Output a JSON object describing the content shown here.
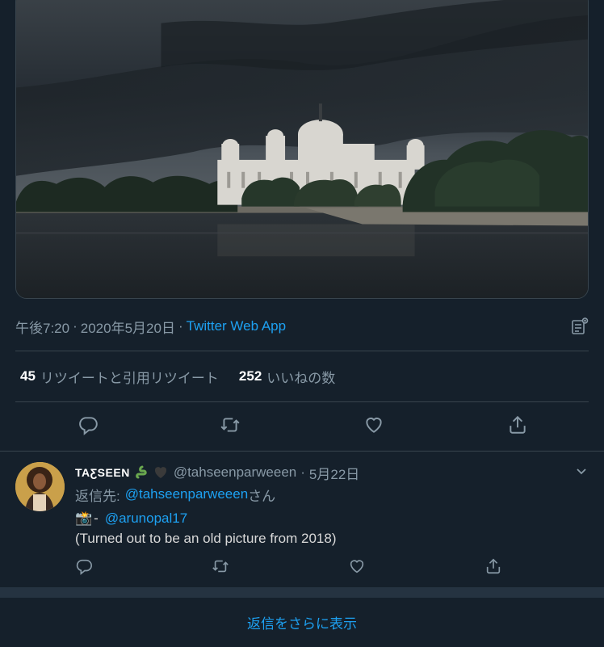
{
  "tweet": {
    "time": "午後7:20",
    "date": "2020年5月20日",
    "sep": "·",
    "source": "Twitter Web App"
  },
  "stats": {
    "retweets_count": "45",
    "retweets_label": "リツイートと引用リツイート",
    "likes_count": "252",
    "likes_label": "いいねの数"
  },
  "reply": {
    "display_name": "TAƸSEEN",
    "handle": "@tahseenparweeen",
    "sep": "·",
    "date": "5月22日",
    "reply_to_prefix": "返信先:",
    "reply_to_mention": "@tahseenparweeen",
    "reply_to_suffix": "さん",
    "camera_emoji": "📸",
    "dash": "-",
    "mention": "@arunopal17",
    "text": "(Turned out to be an old picture from 2018)"
  },
  "show_more_replies": "返信をさらに表示",
  "colors": {
    "background": "#15202b",
    "accent": "#1da1f2",
    "secondary_text": "#8899a6",
    "divider": "#38444d"
  },
  "icons": [
    "analytics-icon",
    "reply-icon",
    "retweet-icon",
    "like-icon",
    "share-icon",
    "chevron-down-icon",
    "camera-emoji-icon"
  ]
}
